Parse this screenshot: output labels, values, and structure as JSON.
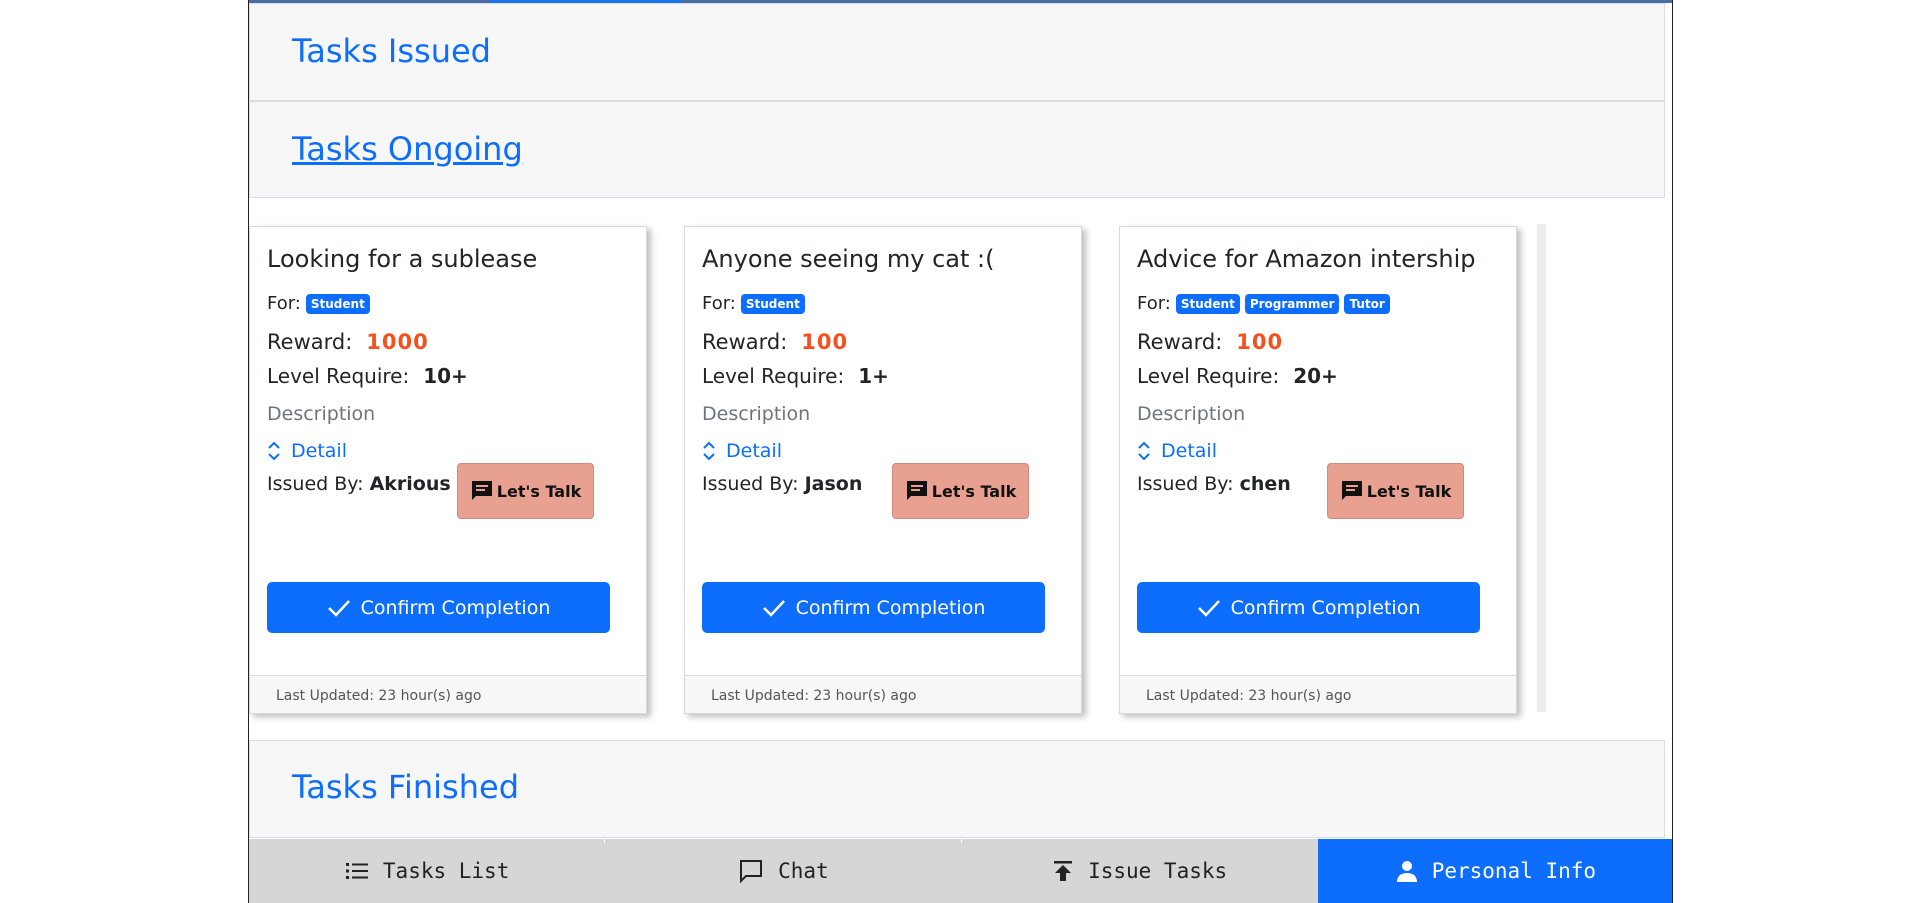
{
  "accordion": {
    "issued_title": "Tasks Issued",
    "ongoing_title": "Tasks Ongoing",
    "finished_title": "Tasks Finished"
  },
  "labels": {
    "for": "For:",
    "reward": "Reward:",
    "level": "Level Require:",
    "description": "Description",
    "detail": "Detail",
    "issued_by": "Issued By:",
    "lets_talk": "Let's Talk",
    "confirm": "Confirm Completion"
  },
  "cards": [
    {
      "title": "Looking for a sublease",
      "tags": [
        "Student"
      ],
      "reward": "1000",
      "level": "10+",
      "issuer": "Akrious",
      "updated": "Last Updated: 23 hour(s) ago"
    },
    {
      "title": "Anyone seeing my cat :(",
      "tags": [
        "Student"
      ],
      "reward": "100",
      "level": "1+",
      "issuer": "Jason",
      "updated": "Last Updated: 23 hour(s) ago"
    },
    {
      "title": "Advice for Amazon intership",
      "tags": [
        "Student",
        "Programmer",
        "Tutor"
      ],
      "reward": "100",
      "level": "20+",
      "issuer": "chen",
      "updated": "Last Updated: 23 hour(s) ago"
    }
  ],
  "nav": {
    "items": [
      {
        "label": "Tasks List",
        "icon": "list-icon"
      },
      {
        "label": "Chat",
        "icon": "chat-bubble-icon"
      },
      {
        "label": "Issue Tasks",
        "icon": "upload-icon"
      },
      {
        "label": "Personal Info",
        "icon": "person-icon"
      }
    ],
    "active": "Personal Info"
  },
  "colors": {
    "primary": "#0d6efd",
    "reward": "#f4511e",
    "talk_button": "#e8a090",
    "nav_bg": "#d6d6d6"
  }
}
